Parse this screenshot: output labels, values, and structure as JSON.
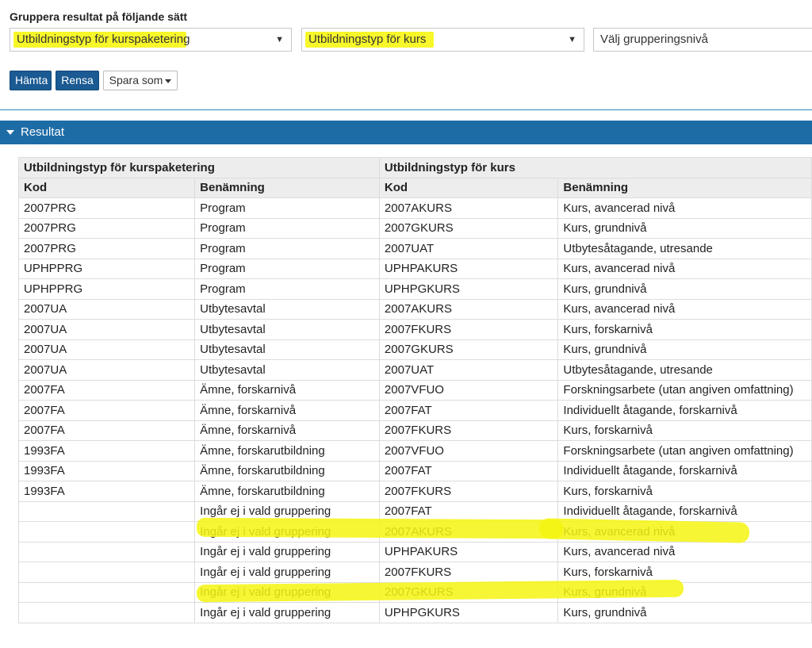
{
  "filter": {
    "label": "Gruppera resultat på följande sätt",
    "select1": "Utbildningstyp för kurspaketering",
    "select2": "Utbildningstyp för kurs",
    "select3": "Välj grupperingsnivå"
  },
  "buttons": {
    "hamta": "Hämta",
    "rensa": "Rensa",
    "spara": "Spara som"
  },
  "result": {
    "title": "Resultat",
    "group1": "Utbildningstyp för kurspaketering",
    "group2": "Utbildningstyp för kurs",
    "columns": [
      "Kod",
      "Benämning",
      "Kod",
      "Benämning"
    ],
    "rows": [
      [
        "2007PRG",
        "Program",
        "2007AKURS",
        "Kurs, avancerad nivå"
      ],
      [
        "2007PRG",
        "Program",
        "2007GKURS",
        "Kurs, grundnivå"
      ],
      [
        "2007PRG",
        "Program",
        "2007UAT",
        "Utbytesåtagande, utresande"
      ],
      [
        "UPHPPRG",
        "Program",
        "UPHPAKURS",
        "Kurs, avancerad nivå"
      ],
      [
        "UPHPPRG",
        "Program",
        "UPHPGKURS",
        "Kurs, grundnivå"
      ],
      [
        "2007UA",
        "Utbytesavtal",
        "2007AKURS",
        "Kurs, avancerad nivå"
      ],
      [
        "2007UA",
        "Utbytesavtal",
        "2007FKURS",
        "Kurs, forskarnivå"
      ],
      [
        "2007UA",
        "Utbytesavtal",
        "2007GKURS",
        "Kurs, grundnivå"
      ],
      [
        "2007UA",
        "Utbytesavtal",
        "2007UAT",
        "Utbytesåtagande, utresande"
      ],
      [
        "2007FA",
        "Ämne, forskarnivå",
        "2007VFUO",
        "Forskningsarbete (utan angiven omfattning)"
      ],
      [
        "2007FA",
        "Ämne, forskarnivå",
        "2007FAT",
        "Individuellt åtagande, forskarnivå"
      ],
      [
        "2007FA",
        "Ämne, forskarnivå",
        "2007FKURS",
        "Kurs, forskarnivå"
      ],
      [
        "1993FA",
        "Ämne, forskarutbildning",
        "2007VFUO",
        "Forskningsarbete (utan angiven omfattning)"
      ],
      [
        "1993FA",
        "Ämne, forskarutbildning",
        "2007FAT",
        "Individuellt åtagande, forskarnivå"
      ],
      [
        "1993FA",
        "Ämne, forskarutbildning",
        "2007FKURS",
        "Kurs, forskarnivå"
      ],
      [
        "",
        "Ingår ej i vald gruppering",
        "2007FAT",
        "Individuellt åtagande, forskarnivå"
      ],
      [
        "",
        "Ingår ej i vald gruppering",
        "2007AKURS",
        "Kurs, avancerad nivå"
      ],
      [
        "",
        "Ingår ej i vald gruppering",
        "UPHPAKURS",
        "Kurs, avancerad nivå"
      ],
      [
        "",
        "Ingår ej i vald gruppering",
        "2007FKURS",
        "Kurs, forskarnivå"
      ],
      [
        "",
        "Ingår ej i vald gruppering",
        "2007GKURS",
        "Kurs, grundnivå"
      ],
      [
        "",
        "Ingår ej i vald gruppering",
        "UPHPGKURS",
        "Kurs, grundnivå"
      ]
    ]
  },
  "colors": {
    "primary": "#1b5a92",
    "result_bar": "#1d6ca6",
    "highlight": "#f5f511"
  }
}
